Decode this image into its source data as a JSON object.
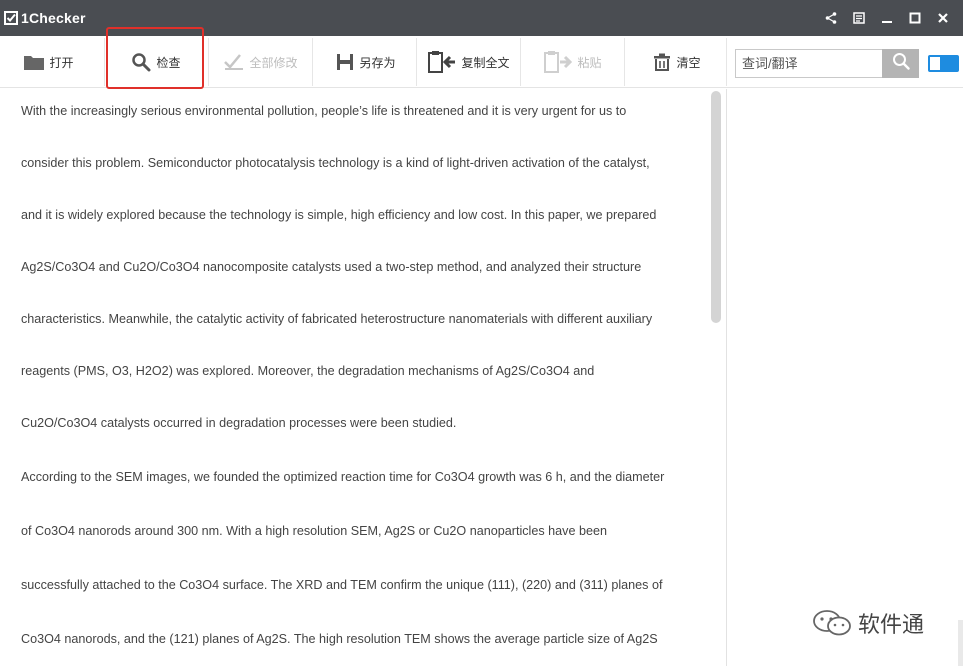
{
  "window": {
    "title": "1Checker",
    "controls": [
      "share-icon",
      "note-icon",
      "minimize-icon",
      "maximize-icon",
      "close-icon"
    ]
  },
  "toolbar": {
    "open_label": "打开",
    "check_label": "检查",
    "fix_all_label": "全部修改",
    "save_as_label": "另存为",
    "copy_all_label": "复制全文",
    "paste_label": "粘贴",
    "clear_label": "清空"
  },
  "search": {
    "placeholder": "查词/翻译"
  },
  "document": {
    "lines": [
      "With the increasingly serious environmental pollution, people’s life is threatened and it is very urgent for us to",
      "consider this problem. Semiconductor photocatalysis technology is a kind of light-driven activation of the catalyst,",
      "and it is widely explored because the technology is simple, high efficiency and low cost. In this paper, we prepared",
      "Ag2S/Co3O4 and Cu2O/Co3O4 nanocomposite catalysts used a two-step method, and analyzed their structure",
      "characteristics. Meanwhile, the catalytic activity of fabricated heterostructure nanomaterials with different auxiliary",
      "reagents (PMS, O3, H2O2) was explored. Moreover, the degradation mechanisms of Ag2S/Co3O4 and",
      "Cu2O/Co3O4 catalysts occurred in degradation processes were been studied.",
      "According to the SEM images, we founded the optimized reaction time for Co3O4 growth was 6 h, and the diameter",
      "of Co3O4 nanorods around 300 nm. With a high resolution SEM, Ag2S or Cu2O nanoparticles have been",
      "successfully attached to the Co3O4 surface. The XRD and TEM confirm the unique (111), (220) and (311) planes of",
      "Co3O4 nanorods, and the (121) planes of Ag2S. The high resolution TEM shows the average particle size of Ag2S"
    ]
  },
  "watermark": {
    "text": "软件通"
  },
  "colors": {
    "titlebar": "#4a4d52",
    "highlight": "#e0302a",
    "accent": "#1e8ce0",
    "search_button": "#b4b4b4"
  }
}
